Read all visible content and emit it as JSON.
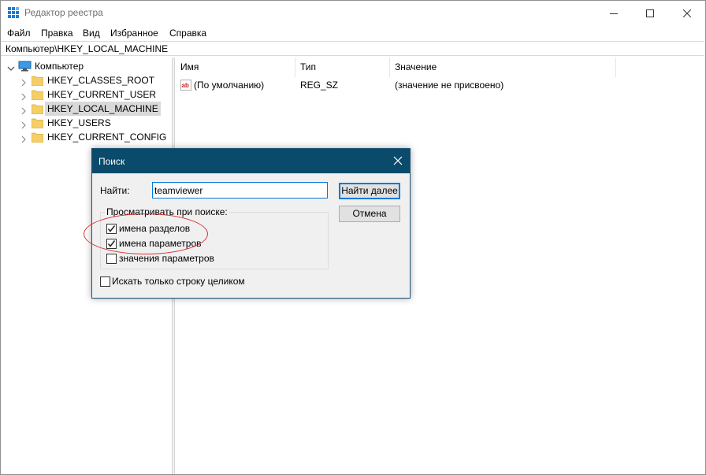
{
  "window": {
    "title": "Редактор реестра"
  },
  "menu": [
    "Файл",
    "Правка",
    "Вид",
    "Избранное",
    "Справка"
  ],
  "address": "Компьютер\\HKEY_LOCAL_MACHINE",
  "tree": {
    "root": "Компьютер",
    "items": [
      {
        "label": "HKEY_CLASSES_ROOT"
      },
      {
        "label": "HKEY_CURRENT_USER"
      },
      {
        "label": "HKEY_LOCAL_MACHINE",
        "selected": true
      },
      {
        "label": "HKEY_USERS"
      },
      {
        "label": "HKEY_CURRENT_CONFIG"
      }
    ]
  },
  "list": {
    "columns": [
      "Имя",
      "Тип",
      "Значение"
    ],
    "rows": [
      {
        "name": "(По умолчанию)",
        "type": "REG_SZ",
        "value": "(значение не присвоено)",
        "icon": "string-value-icon"
      }
    ]
  },
  "dialog": {
    "title": "Поиск",
    "find_label": "Найти:",
    "find_value": "teamviewer",
    "find_next": "Найти далее",
    "cancel": "Отмена",
    "group_title": "Просматривать при поиске:",
    "options": [
      {
        "label": "имена разделов",
        "checked": true
      },
      {
        "label": "имена параметров",
        "checked": true
      },
      {
        "label": "значения параметров",
        "checked": false
      }
    ],
    "whole_string": {
      "label": "Искать только строку целиком",
      "checked": false
    }
  },
  "colors": {
    "dialog_title_bar": "#0a4a6a",
    "highlight_ellipse": "#dd3333",
    "selection": "#d9d9d9"
  }
}
